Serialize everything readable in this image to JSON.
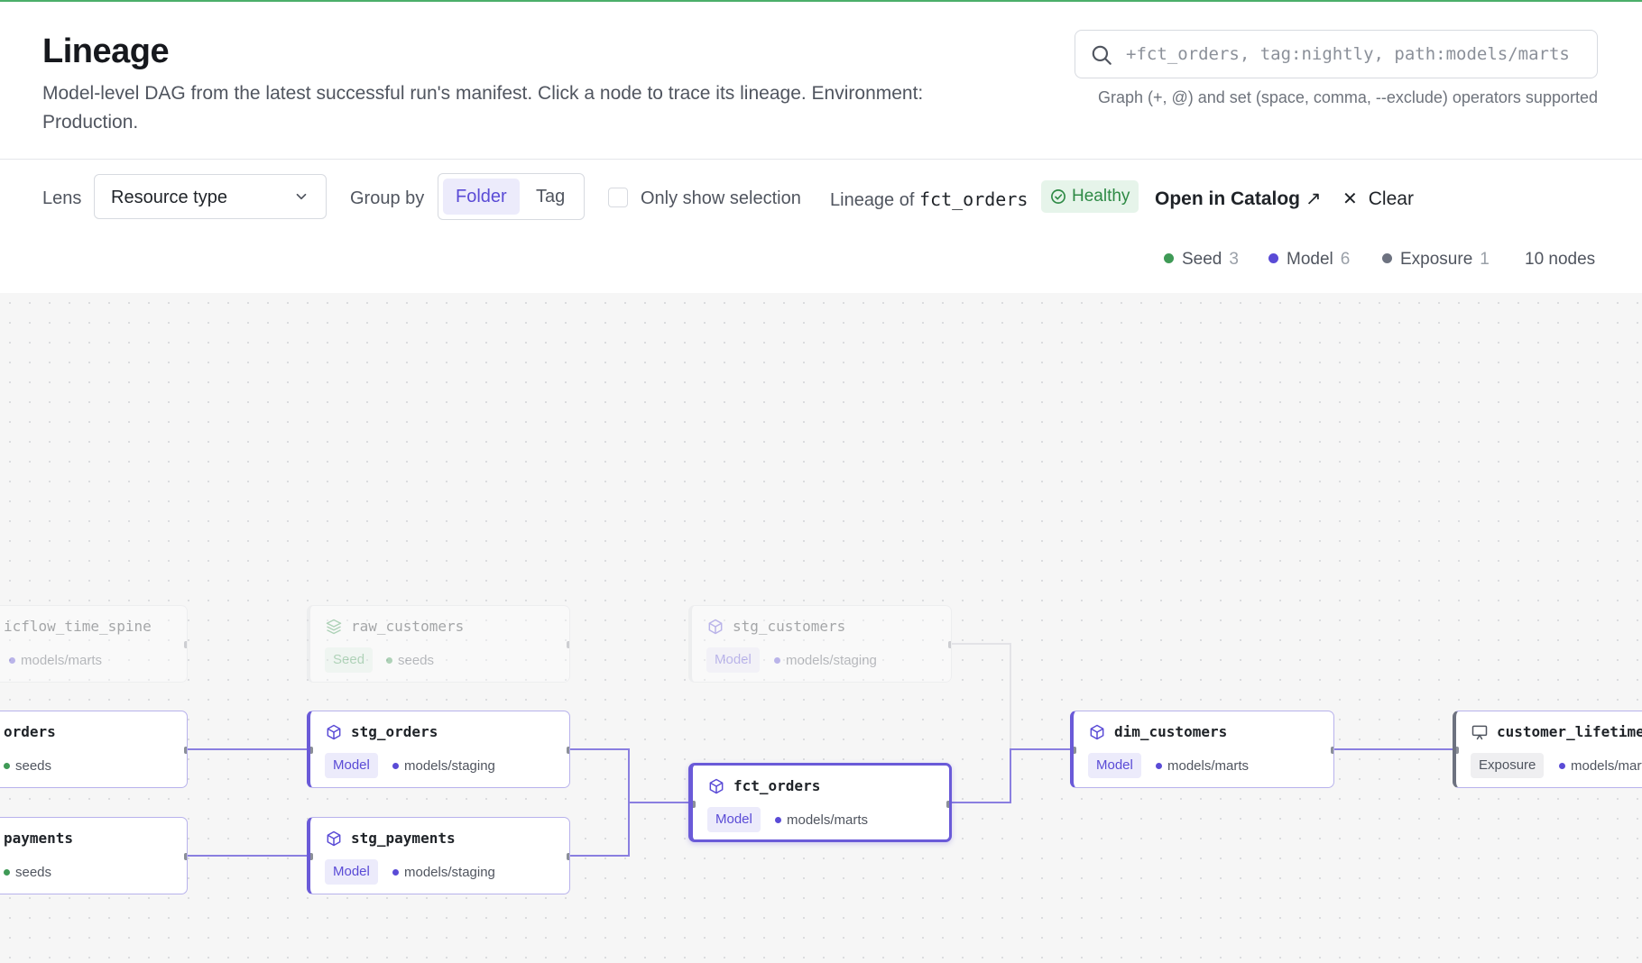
{
  "header": {
    "title": "Lineage",
    "description": "Model-level DAG from the latest successful run's manifest. Click a node to trace its lineage. Environment: Production.",
    "search": {
      "placeholder": "+fct_orders, tag:nightly, path:models/marts",
      "hint": "Graph (+, @) and set (space, comma, --exclude) operators supported"
    }
  },
  "toolbar": {
    "lens_label": "Lens",
    "lens_value": "Resource type",
    "group_by_label": "Group by",
    "group_by_options": [
      "Folder",
      "Tag"
    ],
    "group_by_selected": "Folder",
    "only_show_selection_label": "Only show selection",
    "only_show_selection_checked": false,
    "lineage_of_label": "Lineage of",
    "lineage_of_node": "fct_orders",
    "health_status": "Healthy",
    "open_catalog_label": "Open in Catalog",
    "clear_label": "Clear"
  },
  "legend": {
    "items": [
      {
        "label": "Seed",
        "count": "3",
        "color": "#3f9a56"
      },
      {
        "label": "Model",
        "count": "6",
        "color": "#5a4bd6"
      },
      {
        "label": "Exposure",
        "count": "1",
        "color": "#6d7280"
      }
    ],
    "total": "10 nodes"
  },
  "colors": {
    "accent": "#5a4bd6",
    "seed": "#3f9a56",
    "exposure": "#6d7280",
    "healthy_bg": "#e6f4ea"
  },
  "nodes": {
    "time_spine": {
      "name": "icflow_time_spine",
      "path": "models/marts",
      "icon": "model-icon"
    },
    "raw_customers": {
      "name": "raw_customers",
      "type": "Seed",
      "path": "seeds",
      "icon": "seed-icon"
    },
    "stg_customers": {
      "name": "stg_customers",
      "type": "Model",
      "path": "models/staging",
      "icon": "model-icon"
    },
    "raw_orders": {
      "name": "orders",
      "path": "seeds",
      "icon": "seed-icon"
    },
    "stg_orders": {
      "name": "stg_orders",
      "type": "Model",
      "path": "models/staging",
      "icon": "model-icon"
    },
    "raw_payments": {
      "name": "payments",
      "path": "seeds",
      "icon": "seed-icon"
    },
    "stg_payments": {
      "name": "stg_payments",
      "type": "Model",
      "path": "models/staging",
      "icon": "model-icon"
    },
    "fct_orders": {
      "name": "fct_orders",
      "type": "Model",
      "path": "models/marts",
      "icon": "model-icon"
    },
    "dim_customers": {
      "name": "dim_customers",
      "type": "Model",
      "path": "models/marts",
      "icon": "model-icon"
    },
    "customer_lifetime": {
      "name": "customer_lifetime",
      "type": "Exposure",
      "path": "models/marts",
      "icon": "exposure-icon"
    }
  }
}
